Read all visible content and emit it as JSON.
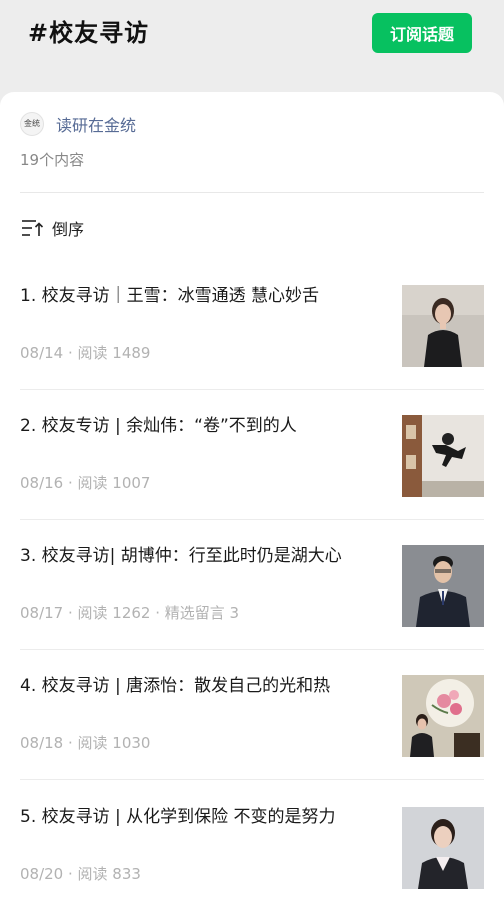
{
  "header": {
    "title": "#校友寻访",
    "subscribe_label": "订阅话题"
  },
  "account": {
    "avatar_text": "金统",
    "name": "读研在金统",
    "count": "19个内容"
  },
  "sort": {
    "label": "倒序"
  },
  "articles": [
    {
      "title": "1. 校友寻访｜王雪：冰雪通透 慧心妙舌",
      "meta": "08/14 · 阅读 1489"
    },
    {
      "title": "2. 校友专访 | 余灿伟：“卷”不到的人",
      "meta": "08/16 · 阅读 1007"
    },
    {
      "title": "3. 校友寻访| 胡博仲：行至此时仍是湖大心",
      "meta": "08/17 · 阅读 1262 · 精选留言 3"
    },
    {
      "title": "4. 校友寻访 | 唐添怡：散发自己的光和热",
      "meta": "08/18 · 阅读 1030"
    },
    {
      "title": "5. 校友寻访 | 从化学到保险 不变的是努力",
      "meta": "08/20 · 阅读 833"
    }
  ],
  "colors": {
    "accent": "#07c160",
    "link": "#576b95",
    "meta": "#b2b2b2"
  }
}
